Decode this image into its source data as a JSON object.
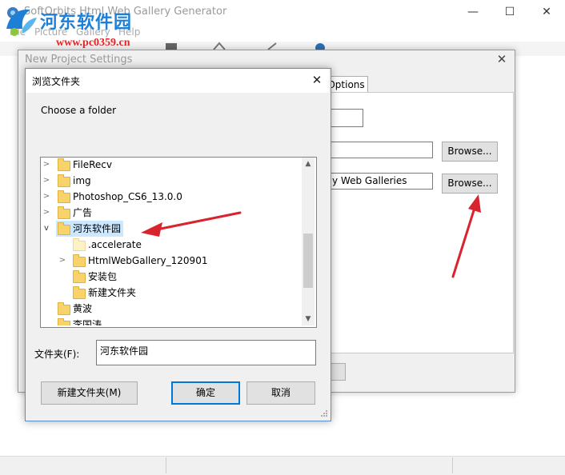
{
  "main_window": {
    "title": "SoftOrbits Html Web Gallery Generator",
    "menu": [
      "File",
      "Picture",
      "Gallery",
      "Help"
    ],
    "controls": {
      "minimize": "—",
      "maximize": "☐",
      "close": "✕"
    }
  },
  "watermark": {
    "site_name": "河东软件园",
    "url": "www.pc0359.cn"
  },
  "new_project_dialog": {
    "title": "New Project Settings",
    "tab_options": "Options",
    "field2_text": "y Web Galleries",
    "browse_label_1": "Browse...",
    "browse_label_2": "Browse..."
  },
  "browse_dialog": {
    "title": "浏览文件夹",
    "prompt": "Choose a folder",
    "tree": [
      {
        "label": "FileRecv"
      },
      {
        "label": "img"
      },
      {
        "label": "Photoshop_CS6_13.0.0"
      },
      {
        "label": "广告"
      },
      {
        "label": "河东软件园"
      },
      {
        "label": ".accelerate"
      },
      {
        "label": "HtmlWebGallery_120901"
      },
      {
        "label": "安装包"
      },
      {
        "label": "新建文件夹"
      },
      {
        "label": "黄波"
      },
      {
        "label": "李国涛"
      }
    ],
    "folder_label": "文件夹(F):",
    "folder_value": "河东软件园",
    "new_folder_button": "新建文件夹(M)",
    "ok_button": "确定",
    "cancel_button": "取消"
  },
  "colors": {
    "accent": "#0078d7",
    "selection": "#cce8ff",
    "arrow": "#d9232d",
    "watermark_blue": "#1d7fd6"
  }
}
